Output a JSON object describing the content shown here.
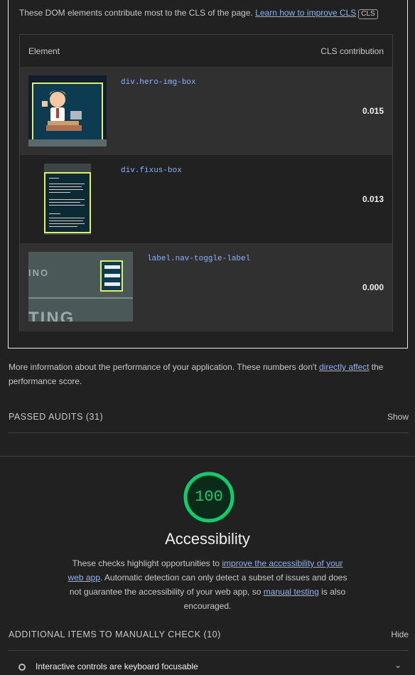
{
  "cls": {
    "intro": "These DOM elements contribute most to the CLS of the page.",
    "learn_link": "Learn how to improve CLS",
    "badge": "CLS",
    "headers": {
      "element": "Element",
      "contribution": "CLS contribution"
    },
    "rows": [
      {
        "selector": "div.hero-img-box",
        "value": "0.015"
      },
      {
        "selector": "div.fixus-box",
        "value": "0.013"
      },
      {
        "selector": "label.nav-toggle-label",
        "value": "0.000"
      }
    ],
    "thumb_texts": {
      "t1": "INO",
      "t2": "TING"
    }
  },
  "perf_note": {
    "before": "More information about the performance of your application. These numbers don't ",
    "link": "directly affect",
    "after": " the performance score."
  },
  "passed": {
    "title": "PASSED AUDITS (31)",
    "toggle": "Show"
  },
  "accessibility": {
    "score": "100",
    "score_value": 100,
    "title": "Accessibility",
    "desc_1": "These checks highlight opportunities to ",
    "link_1": "improve the accessibility of your web app",
    "desc_2": ". Automatic detection can only detect a subset of issues and does not guarantee the accessibility of your web app, so ",
    "link_2": "manual testing",
    "desc_3": " is also encouraged."
  },
  "manual": {
    "title": "ADDITIONAL ITEMS TO MANUALLY CHECK (10)",
    "toggle": "Hide"
  },
  "items": [
    {
      "label": "Interactive controls are keyboard focusable"
    }
  ],
  "colors": {
    "pass": "#0cce6b",
    "link": "#8ab4f8",
    "highlight": "#e6ee5c"
  }
}
